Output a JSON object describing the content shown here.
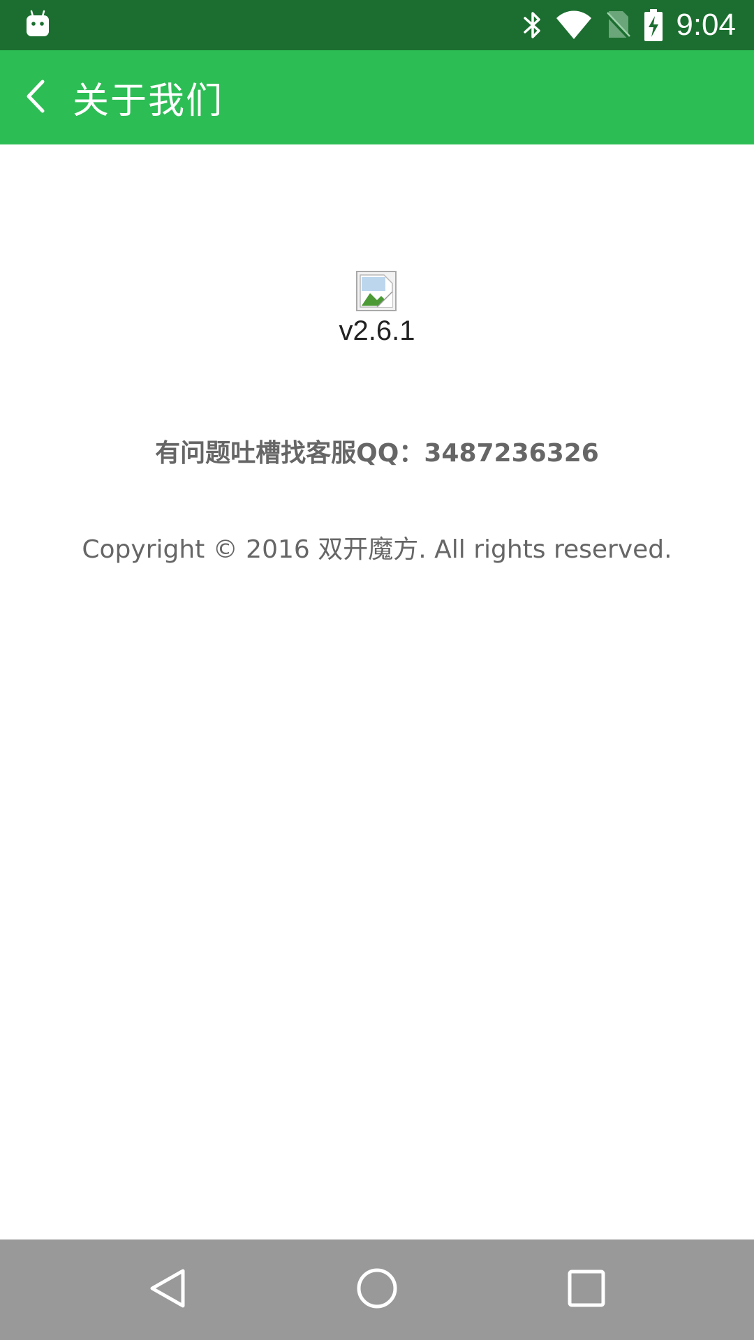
{
  "status_bar": {
    "time": "9:04",
    "icons": [
      "android-notification-icon",
      "bluetooth-icon",
      "wifi-icon",
      "no-sim-icon",
      "battery-charging-icon"
    ],
    "background": "#1b6e2f"
  },
  "toolbar": {
    "title": "关于我们",
    "back_icon": "chevron-left-icon",
    "background": "#2dbd55"
  },
  "about": {
    "app_icon": "broken-image-icon",
    "version": "v2.6.1",
    "contact": "有问题吐槽找客服QQ：3487236326",
    "copyright": "Copyright © 2016 双开魔方. All rights reserved."
  },
  "nav_bar": {
    "buttons": [
      "back-triangle-icon",
      "home-circle-icon",
      "recent-square-icon"
    ],
    "background": "#999999"
  }
}
